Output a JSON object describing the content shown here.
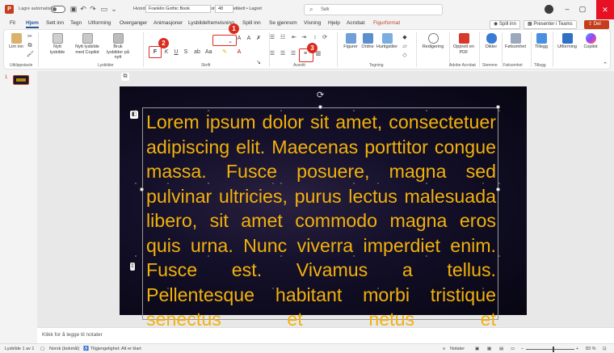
{
  "titlebar": {
    "autosave_label": "Lagre automatisk",
    "doc_title": "Hvordan lage Star Wars tekst i Powerpoint  •  Ingen etikett • Lagret",
    "search_placeholder": "Søk"
  },
  "tabs": [
    "Fil",
    "Hjem",
    "Sett inn",
    "Tegn",
    "Utforming",
    "Overganger",
    "Animasjoner",
    "Lysbildefremvisning",
    "Spill inn",
    "Se gjennom",
    "Visning",
    "Hjelp",
    "Acrobat",
    "Figurformat"
  ],
  "active_tab": "Hjem",
  "top_buttons": {
    "record": "Spill inn",
    "present_teams": "Presenter i Teams",
    "share": "Del"
  },
  "ribbon": {
    "groups": {
      "clipboard": "Utklippstavle",
      "slides": "Lysbilder",
      "font": "Skrift",
      "paragraph": "Avsnitt",
      "drawing": "Tegning",
      "acrobat": "Adobe Acrobat",
      "voice": "Stemme",
      "sensitivity": "Følsomhet",
      "addins": "Tillegg"
    },
    "paste": "Lim inn",
    "new_slide": "Nytt lysbilde",
    "new_slide_copilot": "Nytt lysbilde med Copilot",
    "reuse_slides": "Bruk lysbilder på nytt",
    "font_name": "Franklin Gothic Book",
    "font_size": "48",
    "bold": "F",
    "italic": "K",
    "underline": "U",
    "strike": "S",
    "shapes": "Figurer",
    "arrange": "Ordne",
    "quick_styles": "Hurtigstiler",
    "editing": "Redigering",
    "create_pdf": "Opprett en PDF",
    "dictate": "Dikter",
    "sensitivity_btn": "Følsomhet",
    "addins_btn": "Tillegg",
    "designer": "Utforming",
    "copilot": "Copilot"
  },
  "callouts": [
    "1",
    "2",
    "3"
  ],
  "slide_panel": {
    "number": "1"
  },
  "slide": {
    "text": "Lorem ipsum dolor sit amet, consectetuer adipiscing elit. Maecenas porttitor congue massa. Fusce posuere, magna sed pulvinar ultricies, purus lectus malesuada libero, sit amet commodo magna eros quis urna. Nunc viverra imperdiet enim. Fusce est. Vivamus a tellus. Pellentesque habitant morbi tristique senectus et netus et",
    "text_color": "#f2b10c"
  },
  "notes_placeholder": "Klikk for å legge til notater",
  "statusbar": {
    "slide_info": "Lysbilde 1 av 1",
    "language": "Norsk (bokmål)",
    "accessibility": "Tilgjengelighet: Alt er klart",
    "notes": "Notater",
    "zoom": "83 %"
  },
  "colors": {
    "accent": "#2b579a",
    "brand": "#c43e1c",
    "callout": "#d92c1e"
  }
}
